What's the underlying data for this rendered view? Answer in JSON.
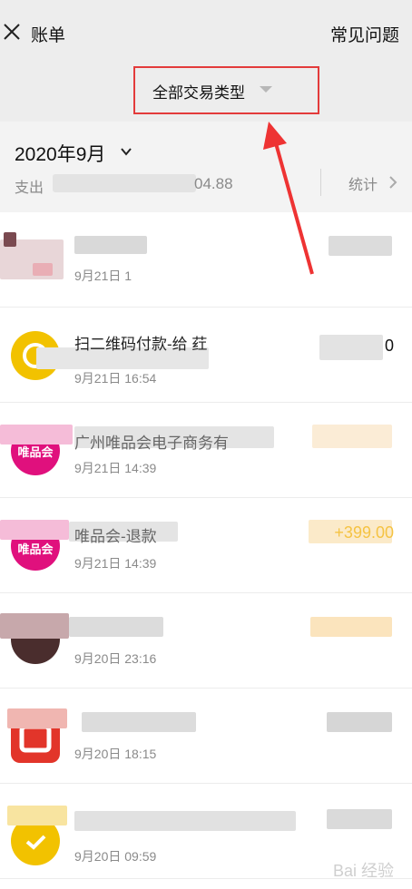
{
  "header": {
    "close_icon": "close-icon",
    "title": "账单",
    "faq_label": "常见问题",
    "filter_label": "全部交易类型"
  },
  "summary": {
    "month": "2020年9月",
    "spend_label": "支出",
    "spend_value_visible": "04.88",
    "stats_label": "统计"
  },
  "transactions": [
    {
      "title": "",
      "time": "9月21日 1",
      "amount": "",
      "avatar_text": "",
      "avatar_color": "#c9a3a8"
    },
    {
      "title": "扫二维码付款-给 荭",
      "time": "9月21日 16:54",
      "amount": "0",
      "avatar_text": "",
      "avatar_color": "#f2c200"
    },
    {
      "title": "广州唯品会电子商务有",
      "time": "9月21日 14:39",
      "amount": "",
      "avatar_text": "唯品会",
      "avatar_color": "#e0107d"
    },
    {
      "title": "唯品会-退款",
      "time": "9月21日 14:39",
      "amount": "+399.00",
      "avatar_text": "唯品会",
      "avatar_color": "#e0107d"
    },
    {
      "title": "",
      "time": "9月20日 23:16",
      "amount": "",
      "avatar_text": "",
      "avatar_color": "#4a2d2d"
    },
    {
      "title": "",
      "time": "9月20日 18:15",
      "amount": "",
      "avatar_text": "",
      "avatar_color": "#e2352a"
    },
    {
      "title": "",
      "time": "9月20日 09:59",
      "amount": "",
      "avatar_text": "",
      "avatar_color": "#f2c200"
    }
  ],
  "watermark": "Bai 经验",
  "colors": {
    "header_bg": "#ededed",
    "summary_bg": "#f3f3f3",
    "highlight_red": "#e33b3b",
    "refund_amount": "#f5c343",
    "vip_pink": "#e0107d"
  }
}
